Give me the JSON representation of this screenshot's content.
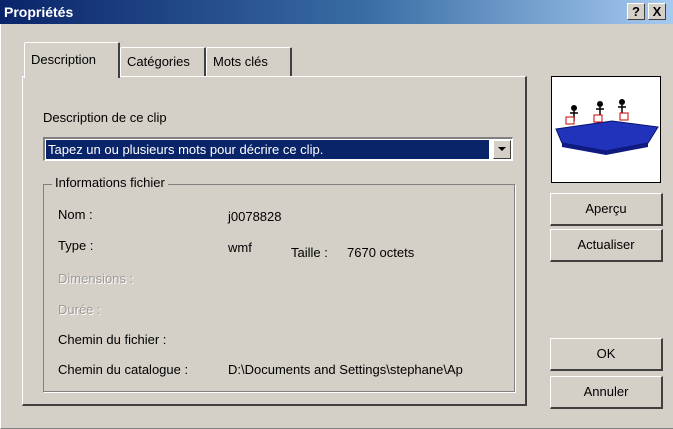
{
  "window": {
    "title": "Propriétés",
    "help_label": "?",
    "close_label": "X"
  },
  "tabs": [
    {
      "label": "Description",
      "active": true
    },
    {
      "label": "Catégories",
      "active": false
    },
    {
      "label": "Mots clés",
      "active": false
    }
  ],
  "description": {
    "label": "Description de ce clip",
    "value": "Tapez un ou plusieurs mots pour décrire ce clip."
  },
  "file_info": {
    "group_title": "Informations fichier",
    "name_label": "Nom :",
    "name_value": "j0078828",
    "type_label": "Type :",
    "type_value": "wmf",
    "size_label": "Taille :",
    "size_value": "7670 octets",
    "dimensions_label": "Dimensions :",
    "duration_label": "Durée :",
    "file_path_label": "Chemin du fichier :",
    "catalog_path_label": "Chemin du catalogue :",
    "catalog_path_value": "D:\\Documents and Settings\\stephane\\Ap"
  },
  "buttons": {
    "preview": "Aperçu",
    "refresh": "Actualiser",
    "ok": "OK",
    "cancel": "Annuler"
  },
  "colors": {
    "title_bar": "#0a246a",
    "selection": "#0a246a",
    "preview_boat": "#2233bb"
  }
}
